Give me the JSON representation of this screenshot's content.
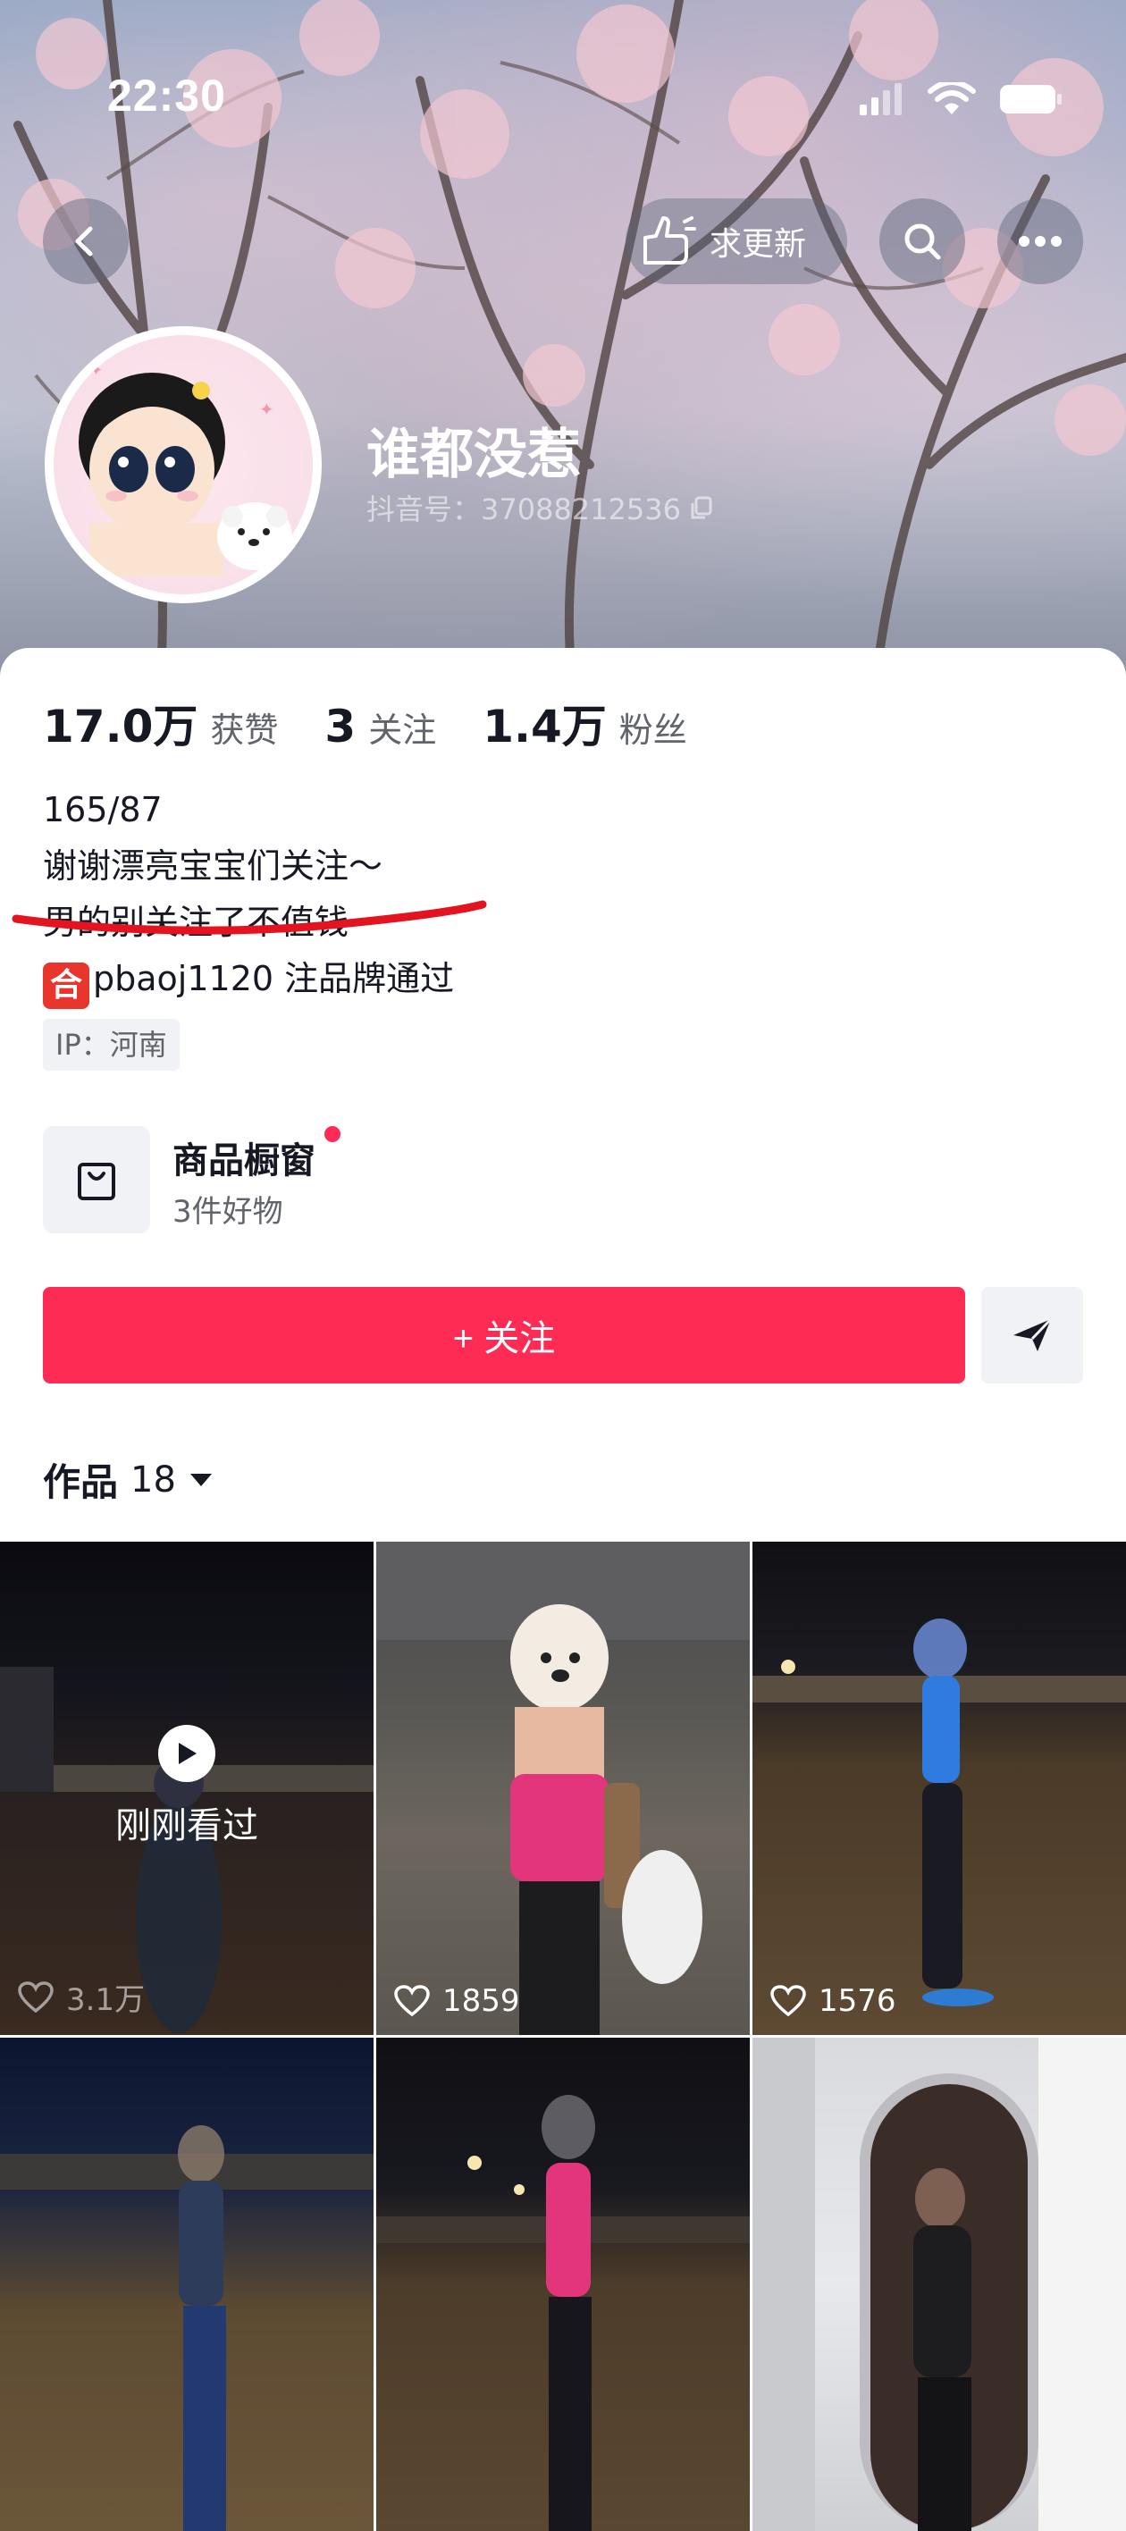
{
  "status_bar": {
    "time": "22:30"
  },
  "header": {
    "update_label": "求更新",
    "nickname": "谁都没惹",
    "douyin_id": "抖音号：37088212536"
  },
  "stats": {
    "likes_num": "17.0万",
    "likes_label": "获赞",
    "following_num": "3",
    "following_label": "关注",
    "fans_num": "1.4万",
    "fans_label": "粉丝"
  },
  "bio": {
    "line1": "165/87",
    "line2": "谢谢漂亮宝宝们关注～",
    "line3": "男的别关注了不值钱",
    "line4_badge": "合",
    "line4_text": "pbaoj1120 注品牌通过"
  },
  "ip_tag": "IP：河南",
  "shop": {
    "title": "商品橱窗",
    "subtitle": "3件好物"
  },
  "actions": {
    "follow_label": "+ 关注"
  },
  "works": {
    "label": "作品",
    "count": "18"
  },
  "videos": [
    {
      "likes": "3.1万",
      "watched_label": "刚刚看过"
    },
    {
      "likes": "1859"
    },
    {
      "likes": "1576"
    },
    {
      "likes": ""
    },
    {
      "likes": ""
    },
    {
      "likes": ""
    }
  ],
  "colors": {
    "accent": "#fe2c55",
    "text": "#161823",
    "secondary": "#62646c"
  }
}
